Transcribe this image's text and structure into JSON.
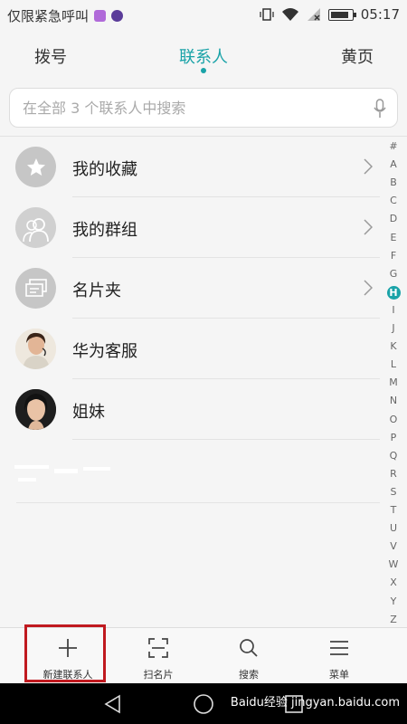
{
  "status": {
    "carrier_text": "仅限紧急呼叫",
    "time": "05:17",
    "colors": {
      "badge1": "#b06ad9",
      "badge2": "#5a3c99"
    }
  },
  "tabs": [
    {
      "label": "拨号",
      "active": false
    },
    {
      "label": "联系人",
      "active": true
    },
    {
      "label": "黄页",
      "active": false
    }
  ],
  "search": {
    "placeholder": "在全部 3 个联系人中搜索",
    "value": ""
  },
  "list": [
    {
      "label": "我的收藏",
      "icon": "star-icon",
      "chevron": true
    },
    {
      "label": "我的群组",
      "icon": "group-icon",
      "chevron": true
    },
    {
      "label": "名片夹",
      "icon": "card-folder-icon",
      "chevron": true
    },
    {
      "label": "华为客服",
      "icon": "avatar-photo",
      "chevron": false
    },
    {
      "label": "姐妹",
      "icon": "avatar-photo",
      "chevron": false
    }
  ],
  "index_letters": [
    "#",
    "A",
    "B",
    "C",
    "D",
    "E",
    "F",
    "G",
    "H",
    "I",
    "J",
    "K",
    "L",
    "M",
    "N",
    "O",
    "P",
    "Q",
    "R",
    "S",
    "T",
    "U",
    "V",
    "W",
    "X",
    "Y",
    "Z"
  ],
  "index_active": "H",
  "bottom": [
    {
      "label": "新建联系人",
      "icon": "plus-icon"
    },
    {
      "label": "扫名片",
      "icon": "scan-icon"
    },
    {
      "label": "搜索",
      "icon": "search-icon"
    },
    {
      "label": "菜单",
      "icon": "menu-icon"
    }
  ],
  "watermark": "Baidu经验 jingyan.baidu.com",
  "accent": "#1aa3a8"
}
